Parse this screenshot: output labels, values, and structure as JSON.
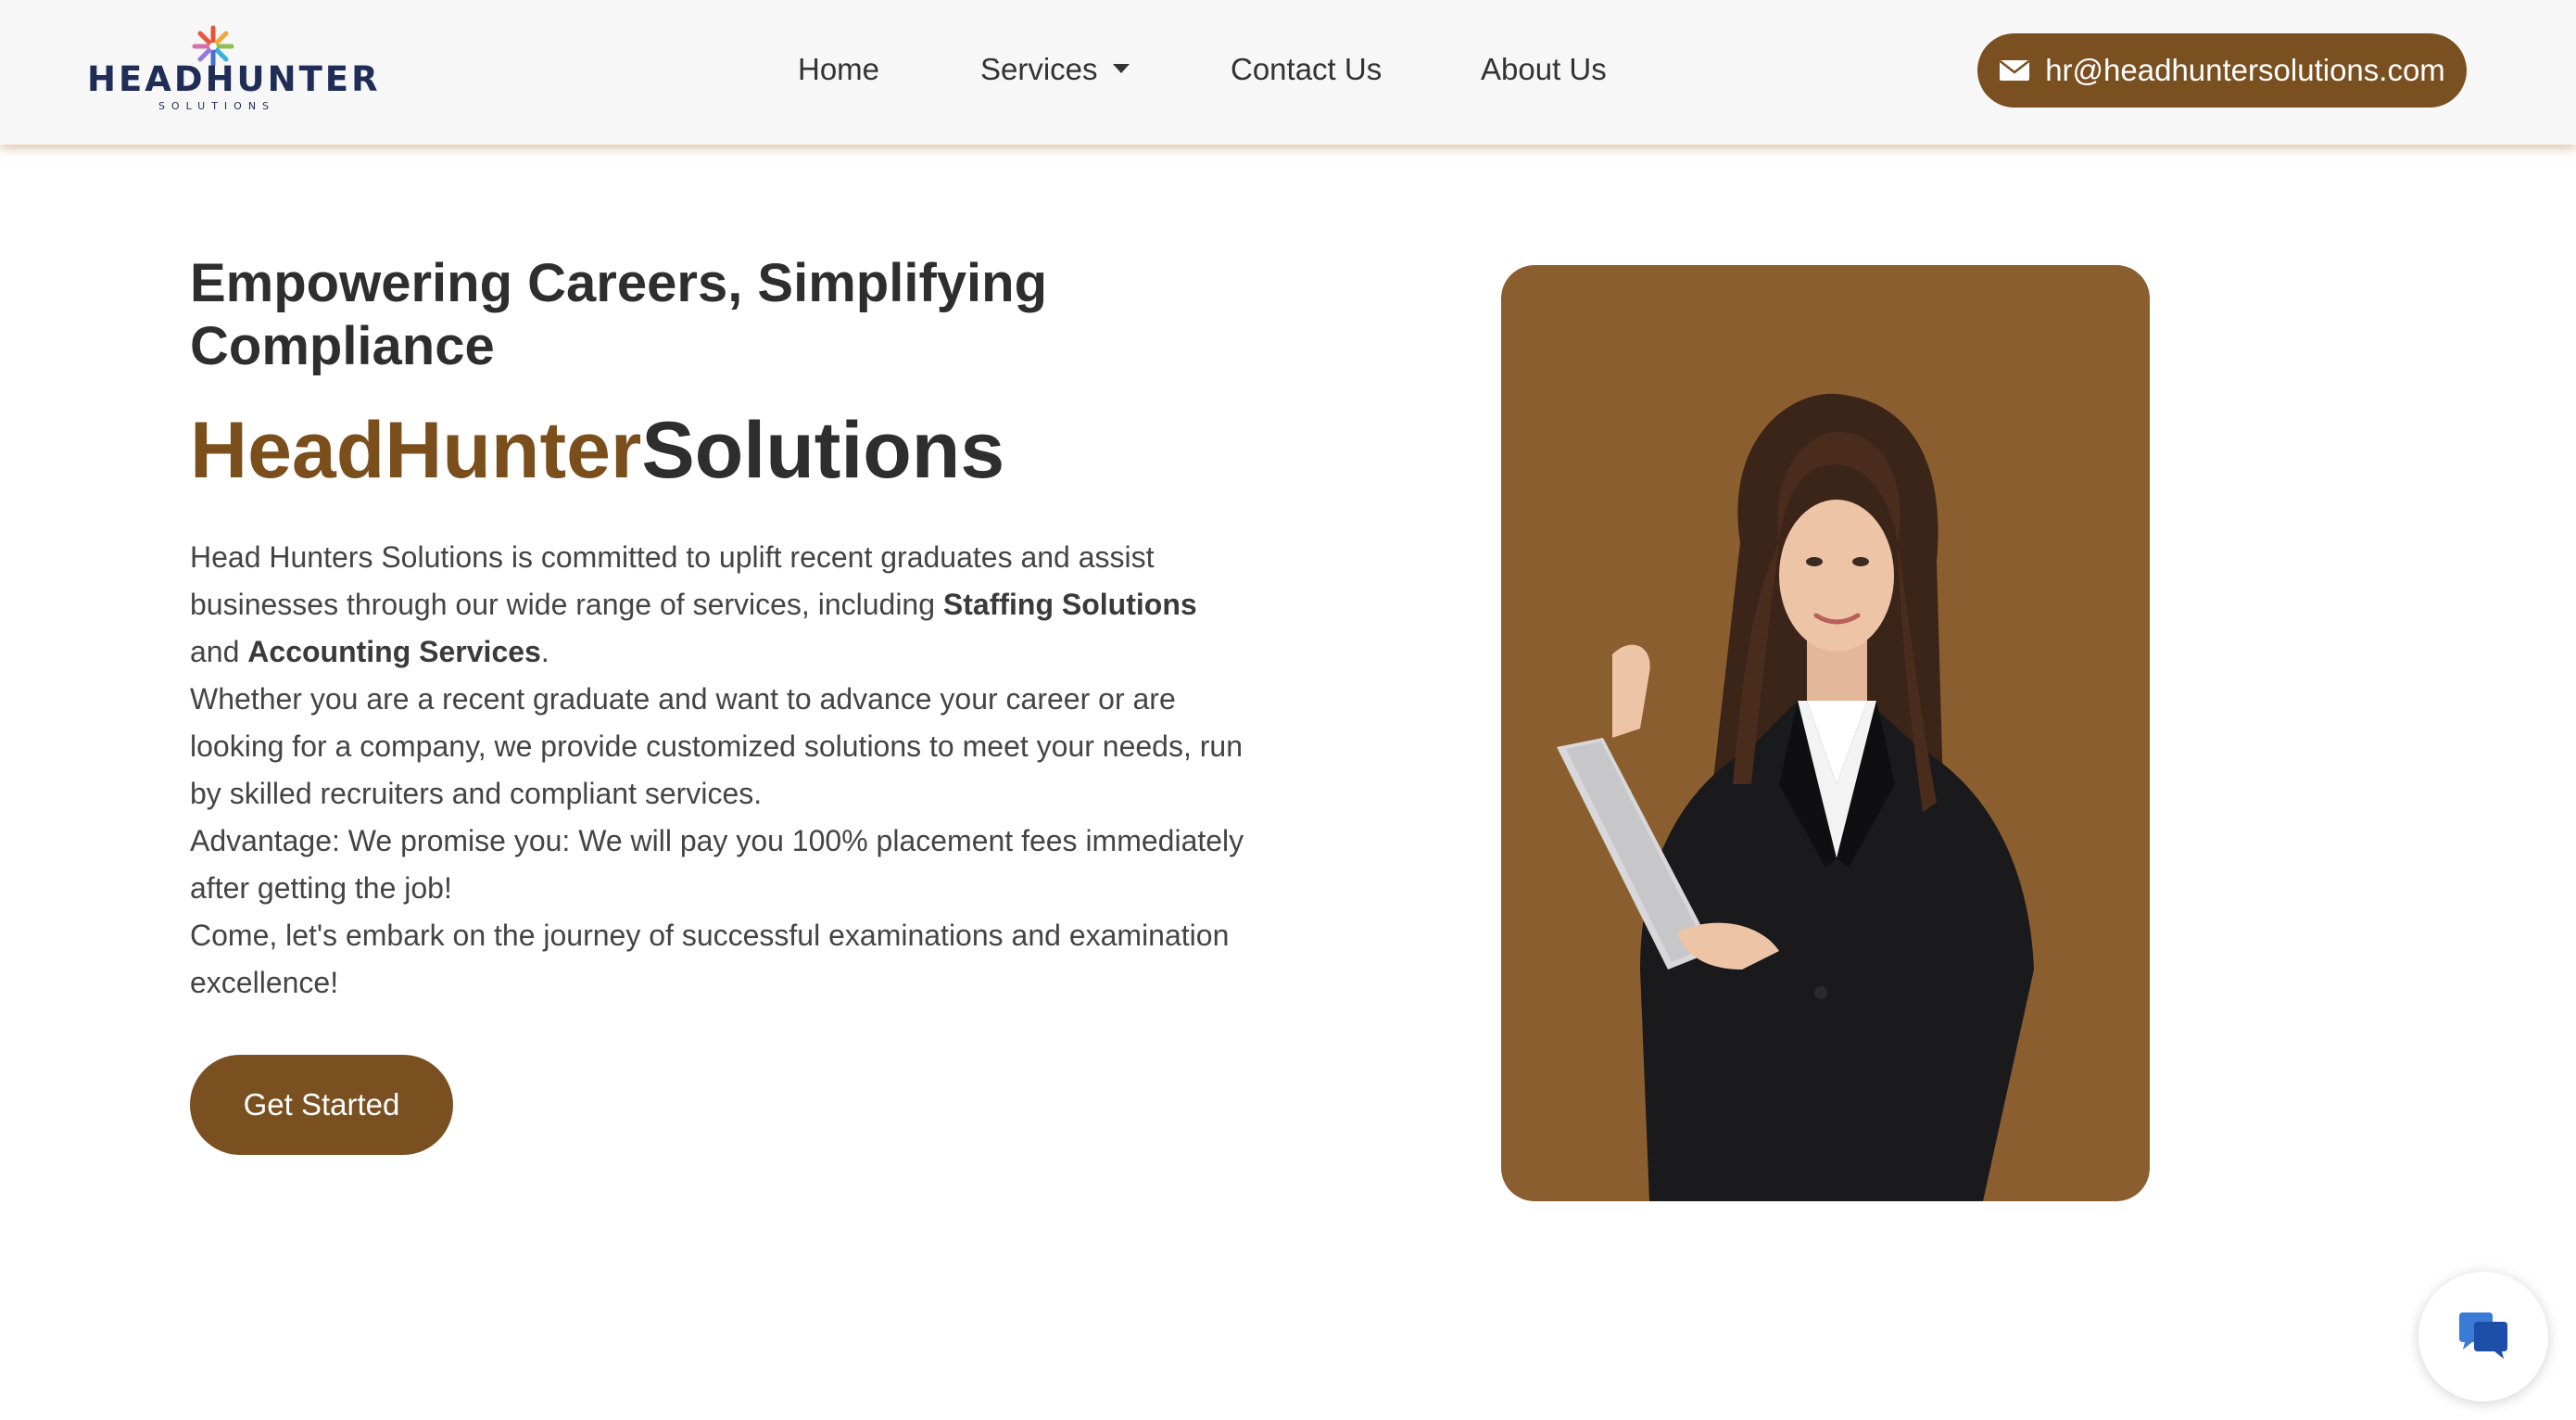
{
  "header": {
    "logo": {
      "word": "HEADHUNTER",
      "sub": "SOLUTIONS"
    },
    "nav": [
      {
        "label": "Home"
      },
      {
        "label": "Services"
      },
      {
        "label": "Contact Us"
      },
      {
        "label": "About Us"
      }
    ],
    "email": "hr@headhuntersolutions.com",
    "email_icon": "envelope-icon",
    "services_icon": "caret-down-icon"
  },
  "hero": {
    "tagline": "Empowering Careers, Simplifying Compliance",
    "brand_accent": "HeadHunter",
    "brand_rest": "Solutions",
    "intro": {
      "p1_start": "Head Hunters Solutions is committed to uplift recent graduates and assist businesses through our wide range of services, including ",
      "p1_bold1": "Staffing Solutions",
      "p1_mid": " and ",
      "p1_bold2": "Accounting Services",
      "p1_end": ".",
      "p2": "Whether you are a recent graduate and want to advance your career or are looking for a company, we provide customized solutions to meet your needs, run by skilled recruiters and compliant services.",
      "p3": "Advantage: We promise you: We will pay you 100% placement fees immediately after getting the job!",
      "p4": "Come, let's embark on the journey of successful examinations and examination excellence!"
    },
    "cta_label": "Get Started"
  },
  "chat_widget": {
    "icon": "chat-bubbles-icon"
  },
  "colors": {
    "accent": "#7a5020",
    "photo_background": "#8b5e30",
    "brand_accent_text": "#7a4f1c",
    "logo_navy": "#1f2d57"
  }
}
